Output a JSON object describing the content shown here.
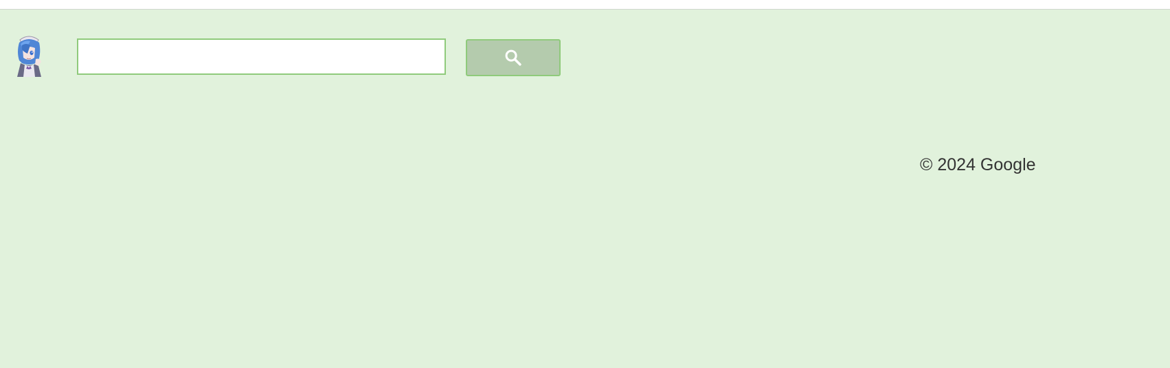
{
  "header": {
    "avatar_icon": "anime-character-avatar-icon"
  },
  "search": {
    "value": "",
    "placeholder": "",
    "button_icon": "search-icon"
  },
  "footer": {
    "copyright": "© 2024 Google"
  },
  "colors": {
    "background": "#e1f2dc",
    "accent_border": "#8fca7b",
    "button_fill": "#b4cbad"
  }
}
